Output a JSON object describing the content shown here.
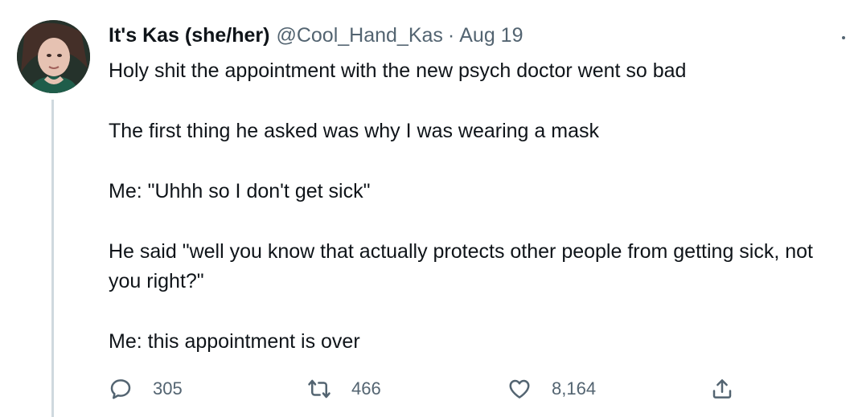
{
  "tweet": {
    "author": {
      "display_name": "It's Kas (she/her)",
      "handle": "@Cool_Hand_Kas",
      "avatar": "avatar-photo"
    },
    "separator": "·",
    "date": "Aug 19",
    "paragraphs": [
      "Holy shit the appointment with the new psych doctor went so bad",
      "The first thing he asked was why I was wearing a mask",
      "Me: \"Uhhh so I don't get sick\"",
      "He said \"well you know that actually protects other people from getting sick, not you right?\"",
      "Me: this appointment is over"
    ],
    "actions": {
      "reply": {
        "icon": "reply-icon",
        "count": "305"
      },
      "retweet": {
        "icon": "retweet-icon",
        "count": "466"
      },
      "like": {
        "icon": "heart-icon",
        "count": "8,164"
      },
      "share": {
        "icon": "share-icon"
      }
    },
    "more_icon": "more-icon"
  },
  "colors": {
    "text_primary": "#0f1419",
    "text_secondary": "#536471",
    "thread_line": "#cfd9de"
  }
}
